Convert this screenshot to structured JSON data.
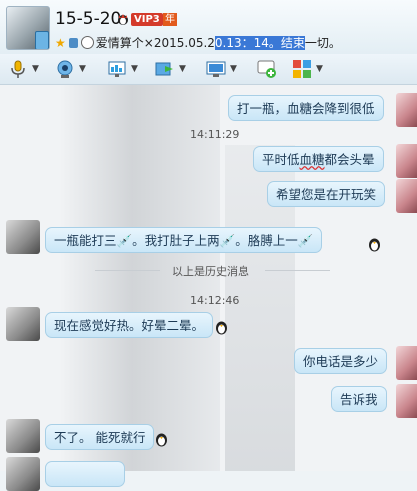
{
  "contact": {
    "name": "15-5-20",
    "vip_badge": "VIP3",
    "year_badge": "年",
    "signature_pre": "爱情算个",
    "signature_sep": "×",
    "signature_mid": "2015.05.2",
    "signature_highlight": "0.13：14。结束",
    "signature_post": "一切。"
  },
  "toolbar": {
    "items": [
      "microphone-icon",
      "video-camera-icon",
      "screen-share-icon",
      "file-transfer-icon",
      "remote-desktop-icon",
      "add-chat-icon",
      "apps-icon"
    ]
  },
  "messages": [
    {
      "side": "right",
      "text": "打一瓶，血糖会降到很低"
    },
    {
      "side": "time",
      "text": "14:11:29"
    },
    {
      "side": "right",
      "text": "平时低血糖都会头晕"
    },
    {
      "side": "right",
      "text": "希望您是在开玩笑"
    },
    {
      "side": "left",
      "text_a": "一瓶能打三",
      "text_b": "。我打肚子上两",
      "text_c": "。胳膊上一"
    },
    {
      "side": "history",
      "text": "以上是历史消息"
    },
    {
      "side": "time",
      "text": "14:12:46"
    },
    {
      "side": "left",
      "text": "现在感觉好热。好晕二晕。"
    },
    {
      "side": "right",
      "text": "你电话是多少"
    },
    {
      "side": "right",
      "text": "告诉我"
    },
    {
      "side": "left",
      "text": "不了。 能死就行"
    }
  ],
  "colors": {
    "bubble": "#d6eefb",
    "vip": "#d43a2a",
    "highlight": "#3a78d6"
  }
}
